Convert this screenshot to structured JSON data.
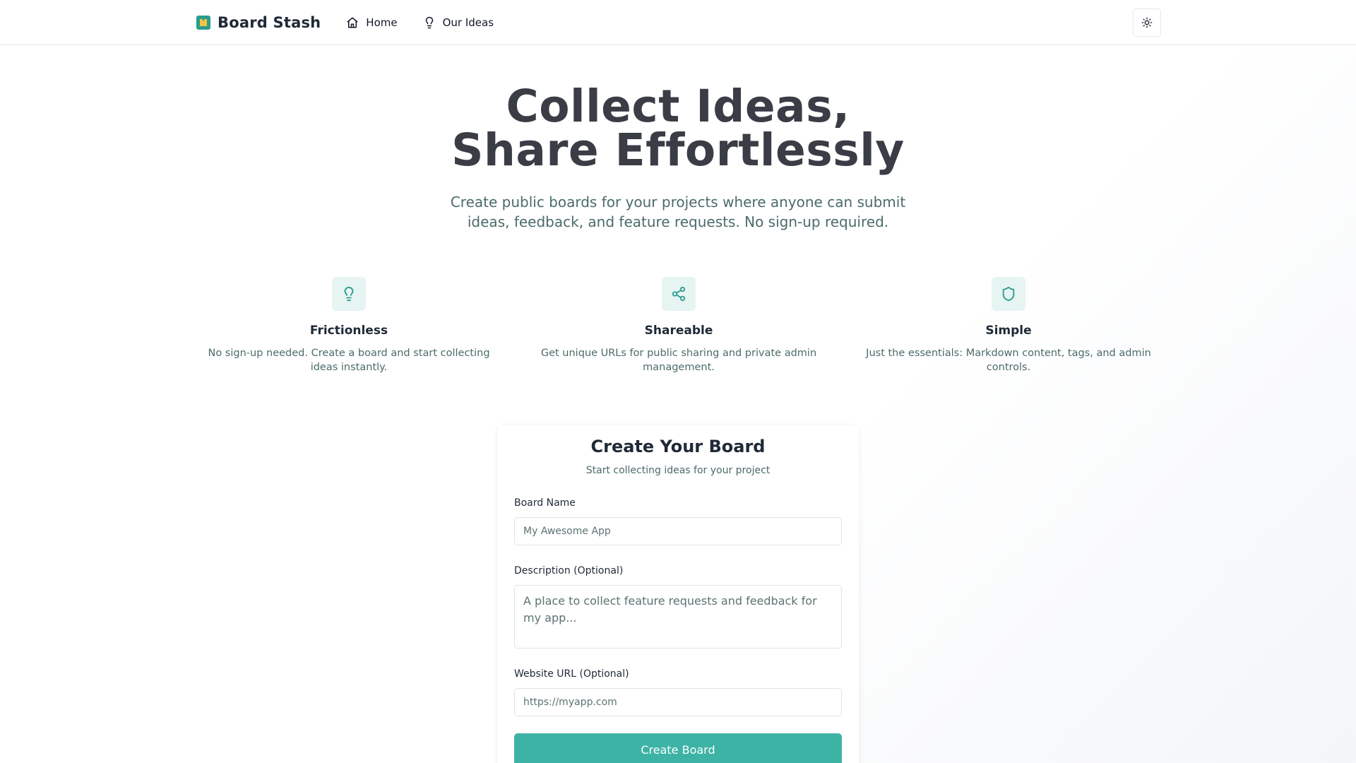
{
  "header": {
    "brand_name": "Board Stash",
    "brand_logo_icon": "board-logo-icon",
    "nav": [
      {
        "label": "Home",
        "icon": "home-icon"
      },
      {
        "label": "Our Ideas",
        "icon": "lightbulb-icon"
      }
    ],
    "theme_toggle_icon": "sun-icon"
  },
  "hero": {
    "title_line1": "Collect Ideas,",
    "title_line2": "Share Effortlessly",
    "subtitle": "Create public boards for your projects where anyone can submit ideas, feedback, and feature requests. No sign-up required."
  },
  "features": [
    {
      "icon": "lightbulb-icon",
      "title": "Frictionless",
      "description": "No sign-up needed. Create a board and start collecting ideas instantly."
    },
    {
      "icon": "share-icon",
      "title": "Shareable",
      "description": "Get unique URLs for public sharing and private admin management."
    },
    {
      "icon": "shield-icon",
      "title": "Simple",
      "description": "Just the essentials: Markdown content, tags, and admin controls."
    }
  ],
  "create_form": {
    "title": "Create Your Board",
    "subtitle": "Start collecting ideas for your project",
    "board_name_label": "Board Name",
    "board_name_placeholder": "My Awesome App",
    "board_name_value": "",
    "description_label": "Description (Optional)",
    "description_placeholder": "A place to collect feature requests and feedback for my app...",
    "description_value": "",
    "website_label": "Website URL (Optional)",
    "website_placeholder": "https://myapp.com",
    "website_value": "",
    "submit_label": "Create Board"
  },
  "colors": {
    "accent": "#3db3a6",
    "accent_dark": "#2a9d8f",
    "icon_bg": "#e6f4f2",
    "muted_text": "#4b6b6a",
    "heading": "#3a3d45"
  }
}
